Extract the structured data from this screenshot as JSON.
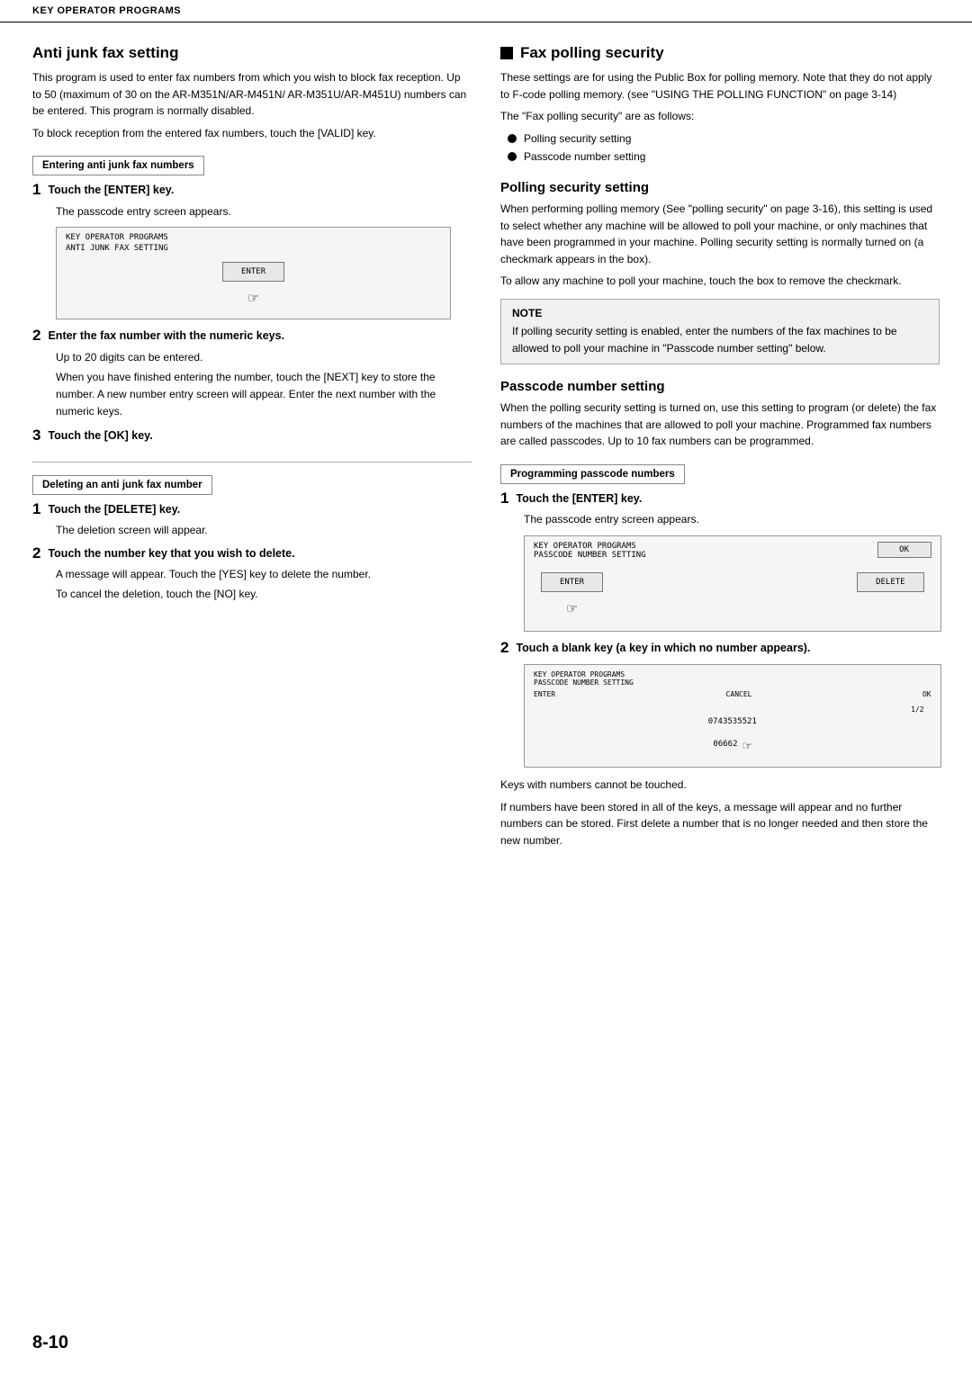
{
  "topbar": {
    "label": "KEY OPERATOR PROGRAMS"
  },
  "left": {
    "main_title": "Anti junk fax setting",
    "intro": "This program is used to enter fax numbers from which you wish to block fax reception. Up to 50 (maximum of 30 on the AR-M351N/AR-M451N/ AR-M351U/AR-M451U) numbers can be entered. This program is normally disabled.",
    "intro2": "To block reception from the entered fax numbers, touch the [VALID] key.",
    "box1_label": "Entering anti junk fax numbers",
    "step1_num": "1",
    "step1_text": "Touch the [ENTER] key.",
    "step1_desc": "The passcode entry screen appears.",
    "screen1": {
      "line1": "KEY OPERATOR PROGRAMS",
      "line2": "ANTI JUNK FAX SETTING",
      "btn": "ENTER"
    },
    "step2_num": "2",
    "step2_text": "Enter the fax number with the numeric keys.",
    "step2_desc1": "Up to 20 digits can be entered.",
    "step2_desc2": "When you have finished entering the number, touch the [NEXT] key to store the number. A new number entry screen will appear. Enter the next number with the numeric keys.",
    "step3_num": "3",
    "step3_text": "Touch the [OK] key.",
    "box2_label": "Deleting an anti junk fax number",
    "del_step1_num": "1",
    "del_step1_text": "Touch the [DELETE] key.",
    "del_step1_desc": "The deletion screen will appear.",
    "del_step2_num": "2",
    "del_step2_text": "Touch the number key that you wish to delete.",
    "del_step2_desc1": "A message will appear. Touch the [YES] key to delete the number.",
    "del_step2_desc2": "To cancel the deletion, touch the [NO] key."
  },
  "right": {
    "main_title": "Fax polling security",
    "intro1": "These settings are for using the Public Box for polling memory. Note that they do not apply to F-code polling memory. (see \"USING THE POLLING FUNCTION\" on page 3-14)",
    "intro2": "The \"Fax polling security\" are as follows:",
    "bullets": [
      "Polling security setting",
      "Passcode number setting"
    ],
    "polling_title": "Polling security setting",
    "polling_text1": "When performing polling memory (See \"polling security\" on page 3-16), this setting is used to select whether any machine will be allowed to poll your machine, or only machines that have been programmed in your machine. Polling security setting is normally turned on (a checkmark appears in the box).",
    "polling_text2": "To allow any machine to poll your machine, touch the box to remove the checkmark.",
    "note_title": "NOTE",
    "note_text": "If polling security setting is enabled, enter the numbers of the fax machines to be allowed to poll your machine in \"Passcode number setting\" below.",
    "passcode_title": "Passcode number setting",
    "passcode_text1": "When the polling security setting is turned on, use this setting to program (or delete) the fax numbers of the machines that are allowed to poll your machine. Programmed fax numbers are called passcodes. Up to 10 fax numbers can be programmed.",
    "box_label": "Programming passcode numbers",
    "pc_step1_num": "1",
    "pc_step1_text": "Touch the [ENTER] key.",
    "pc_step1_desc": "The passcode entry screen appears.",
    "screen2": {
      "line1": "KEY OPERATOR PROGRAMS",
      "line2": "PASSCODE NUMBER SETTING",
      "ok_btn": "OK",
      "enter_btn": "ENTER",
      "delete_btn": "DELETE"
    },
    "pc_step2_num": "2",
    "pc_step2_text": "Touch a blank key (a key in which no number appears).",
    "screen3": {
      "line1": "KEY OPERATOR PROGRAMS",
      "line2": "PASSCODE NUMBER SETTING",
      "enter": "ENTER",
      "cancel": "CANCEL",
      "ok": "OK",
      "page": "1/2",
      "number": "0743535521",
      "prefix": "06662"
    },
    "keys_note1": "Keys with numbers cannot be touched.",
    "keys_note2": "If numbers have been stored in all of the keys, a message will appear and no further numbers can be stored. First delete a number that is no longer needed and then store the new number."
  },
  "page_number": "8-10"
}
